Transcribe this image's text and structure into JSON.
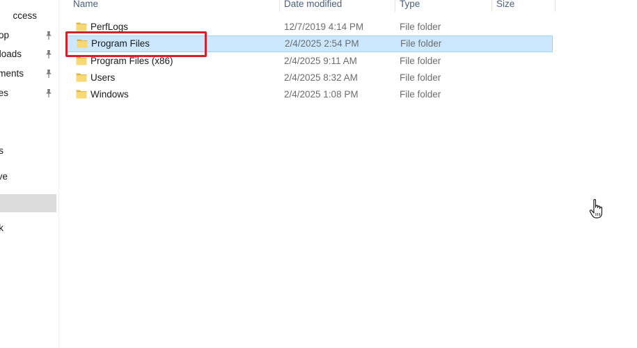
{
  "nav": {
    "items": [
      {
        "label": "ccess",
        "pinned": false,
        "selected": false
      },
      {
        "label": "op",
        "pinned": true,
        "selected": false
      },
      {
        "label": "loads",
        "pinned": true,
        "selected": false
      },
      {
        "label": "ments",
        "pinned": true,
        "selected": false
      },
      {
        "label": "es",
        "pinned": true,
        "selected": false
      },
      {
        "label": "s",
        "pinned": false,
        "selected": false
      },
      {
        "label": "ve",
        "pinned": false,
        "selected": false
      },
      {
        "label": "",
        "pinned": false,
        "selected": true
      },
      {
        "label": "k",
        "pinned": false,
        "selected": false
      }
    ]
  },
  "list": {
    "headers": {
      "name": "Name",
      "date": "Date modified",
      "type": "Type",
      "size": "Size"
    },
    "rows": [
      {
        "name": "PerfLogs",
        "date": "12/7/2019 4:14 PM",
        "type": "File folder",
        "size": ""
      },
      {
        "name": "Program Files",
        "date": "2/4/2025 2:54 PM",
        "type": "File folder",
        "size": ""
      },
      {
        "name": "Program Files (x86)",
        "date": "2/4/2025 9:11 AM",
        "type": "File folder",
        "size": ""
      },
      {
        "name": "Users",
        "date": "2/4/2025 8:32 AM",
        "type": "File folder",
        "size": ""
      },
      {
        "name": "Windows",
        "date": "2/4/2025 1:08 PM",
        "type": "File folder",
        "size": ""
      }
    ],
    "selected_row": "Program Files"
  },
  "annotation": {
    "highlight_color": "#d4212b"
  },
  "colors": {
    "selection_fill": "#cce8ff",
    "selection_border": "#99d1ff",
    "header_text": "#4c607a",
    "folder_yellow": "#f8d775",
    "folder_dark": "#e4b73f"
  },
  "icons": {
    "folder": "folder-icon",
    "pin": "pin-icon",
    "cursor": "hand-cursor-icon"
  }
}
